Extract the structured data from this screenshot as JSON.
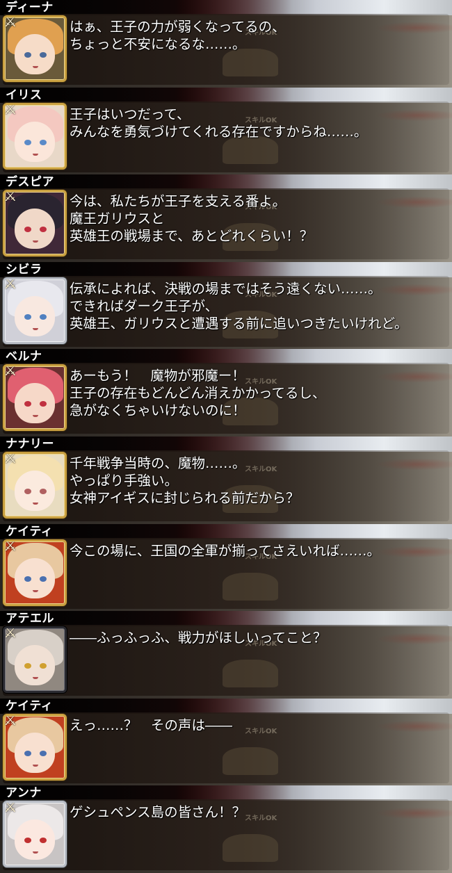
{
  "dialogue_log": [
    {
      "speaker": "ディーナ",
      "lines": [
        "はぁ、王子の力が弱くなってるの、",
        "ちょっと不安になるな……。"
      ],
      "portrait": {
        "frame": "gold",
        "hair": "#e0a050",
        "eyes": "#4a6a9a",
        "skin": "#f6dcc8",
        "bg": "#6a5a3a"
      }
    },
    {
      "speaker": "イリス",
      "lines": [
        "王子はいつだって、",
        "みんなを勇気づけてくれる存在ですからね……。"
      ],
      "portrait": {
        "frame": "gold",
        "hair": "#f4c8c0",
        "eyes": "#5a8ac8",
        "skin": "#fbe6da",
        "bg": "#e8d8c8"
      }
    },
    {
      "speaker": "デスピア",
      "lines": [
        "今は、私たちが王子を支える番よ。",
        "魔王ガリウスと",
        "英雄王の戦場まで、あとどれくらい！？"
      ],
      "portrait": {
        "frame": "gold",
        "hair": "#2a2430",
        "eyes": "#c03040",
        "skin": "#f0d8c8",
        "bg": "#402838"
      }
    },
    {
      "speaker": "シビラ",
      "lines": [
        "伝承によれば、決戦の場まではそう遠くない……。",
        "できればダーク王子が、",
        "英雄王、ガリウスと遭遇する前に追いつきたいけれど。"
      ],
      "portrait": {
        "frame": "silver",
        "hair": "#e8e8ee",
        "eyes": "#5080c0",
        "skin": "#f8e8e0",
        "bg": "#d0d0d8"
      }
    },
    {
      "speaker": "ベルナ",
      "lines": [
        "あーもう！　魔物が邪魔ー！",
        "王子の存在もどんどん消えかかってるし、",
        "急がなくちゃいけないのに！"
      ],
      "portrait": {
        "frame": "gold",
        "hair": "#e06070",
        "eyes": "#c03040",
        "skin": "#f6d8c8",
        "bg": "#6a3030"
      }
    },
    {
      "speaker": "ナナリー",
      "lines": [
        "千年戦争当時の、魔物……。",
        "やっぱり手強い。",
        "女神アイギスに封じられる前だから？"
      ],
      "portrait": {
        "frame": "gold",
        "hair": "#f4e0b0",
        "eyes": "#b06060",
        "skin": "#fbeade",
        "bg": "#e8dcc0"
      }
    },
    {
      "speaker": "ケイティ",
      "lines": [
        "今この場に、王国の全軍が揃ってさえいれば……。"
      ],
      "portrait": {
        "frame": "gold",
        "hair": "#e8c8a0",
        "eyes": "#4a70b0",
        "skin": "#f8e0d0",
        "bg": "#c04020"
      }
    },
    {
      "speaker": "アテエル",
      "lines": [
        "――ふっふっふ、戦力がほしいってこと？"
      ],
      "portrait": {
        "frame": "black",
        "hair": "#d8d0c8",
        "eyes": "#d0a030",
        "skin": "#f0e0d4",
        "bg": "#908880"
      }
    },
    {
      "speaker": "ケイティ",
      "lines": [
        "えっ……？　その声は――"
      ],
      "portrait": {
        "frame": "gold",
        "hair": "#e8c8a0",
        "eyes": "#4a70b0",
        "skin": "#f8e0d0",
        "bg": "#c04020"
      }
    },
    {
      "speaker": "アンナ",
      "lines": [
        "ゲシュペンス島の皆さん！？"
      ],
      "portrait": {
        "frame": "silver",
        "hair": "#ece8e8",
        "eyes": "#c03030",
        "skin": "#fbe8e0",
        "bg": "#c8c4c4"
      }
    }
  ],
  "background_text": "スキルOK"
}
